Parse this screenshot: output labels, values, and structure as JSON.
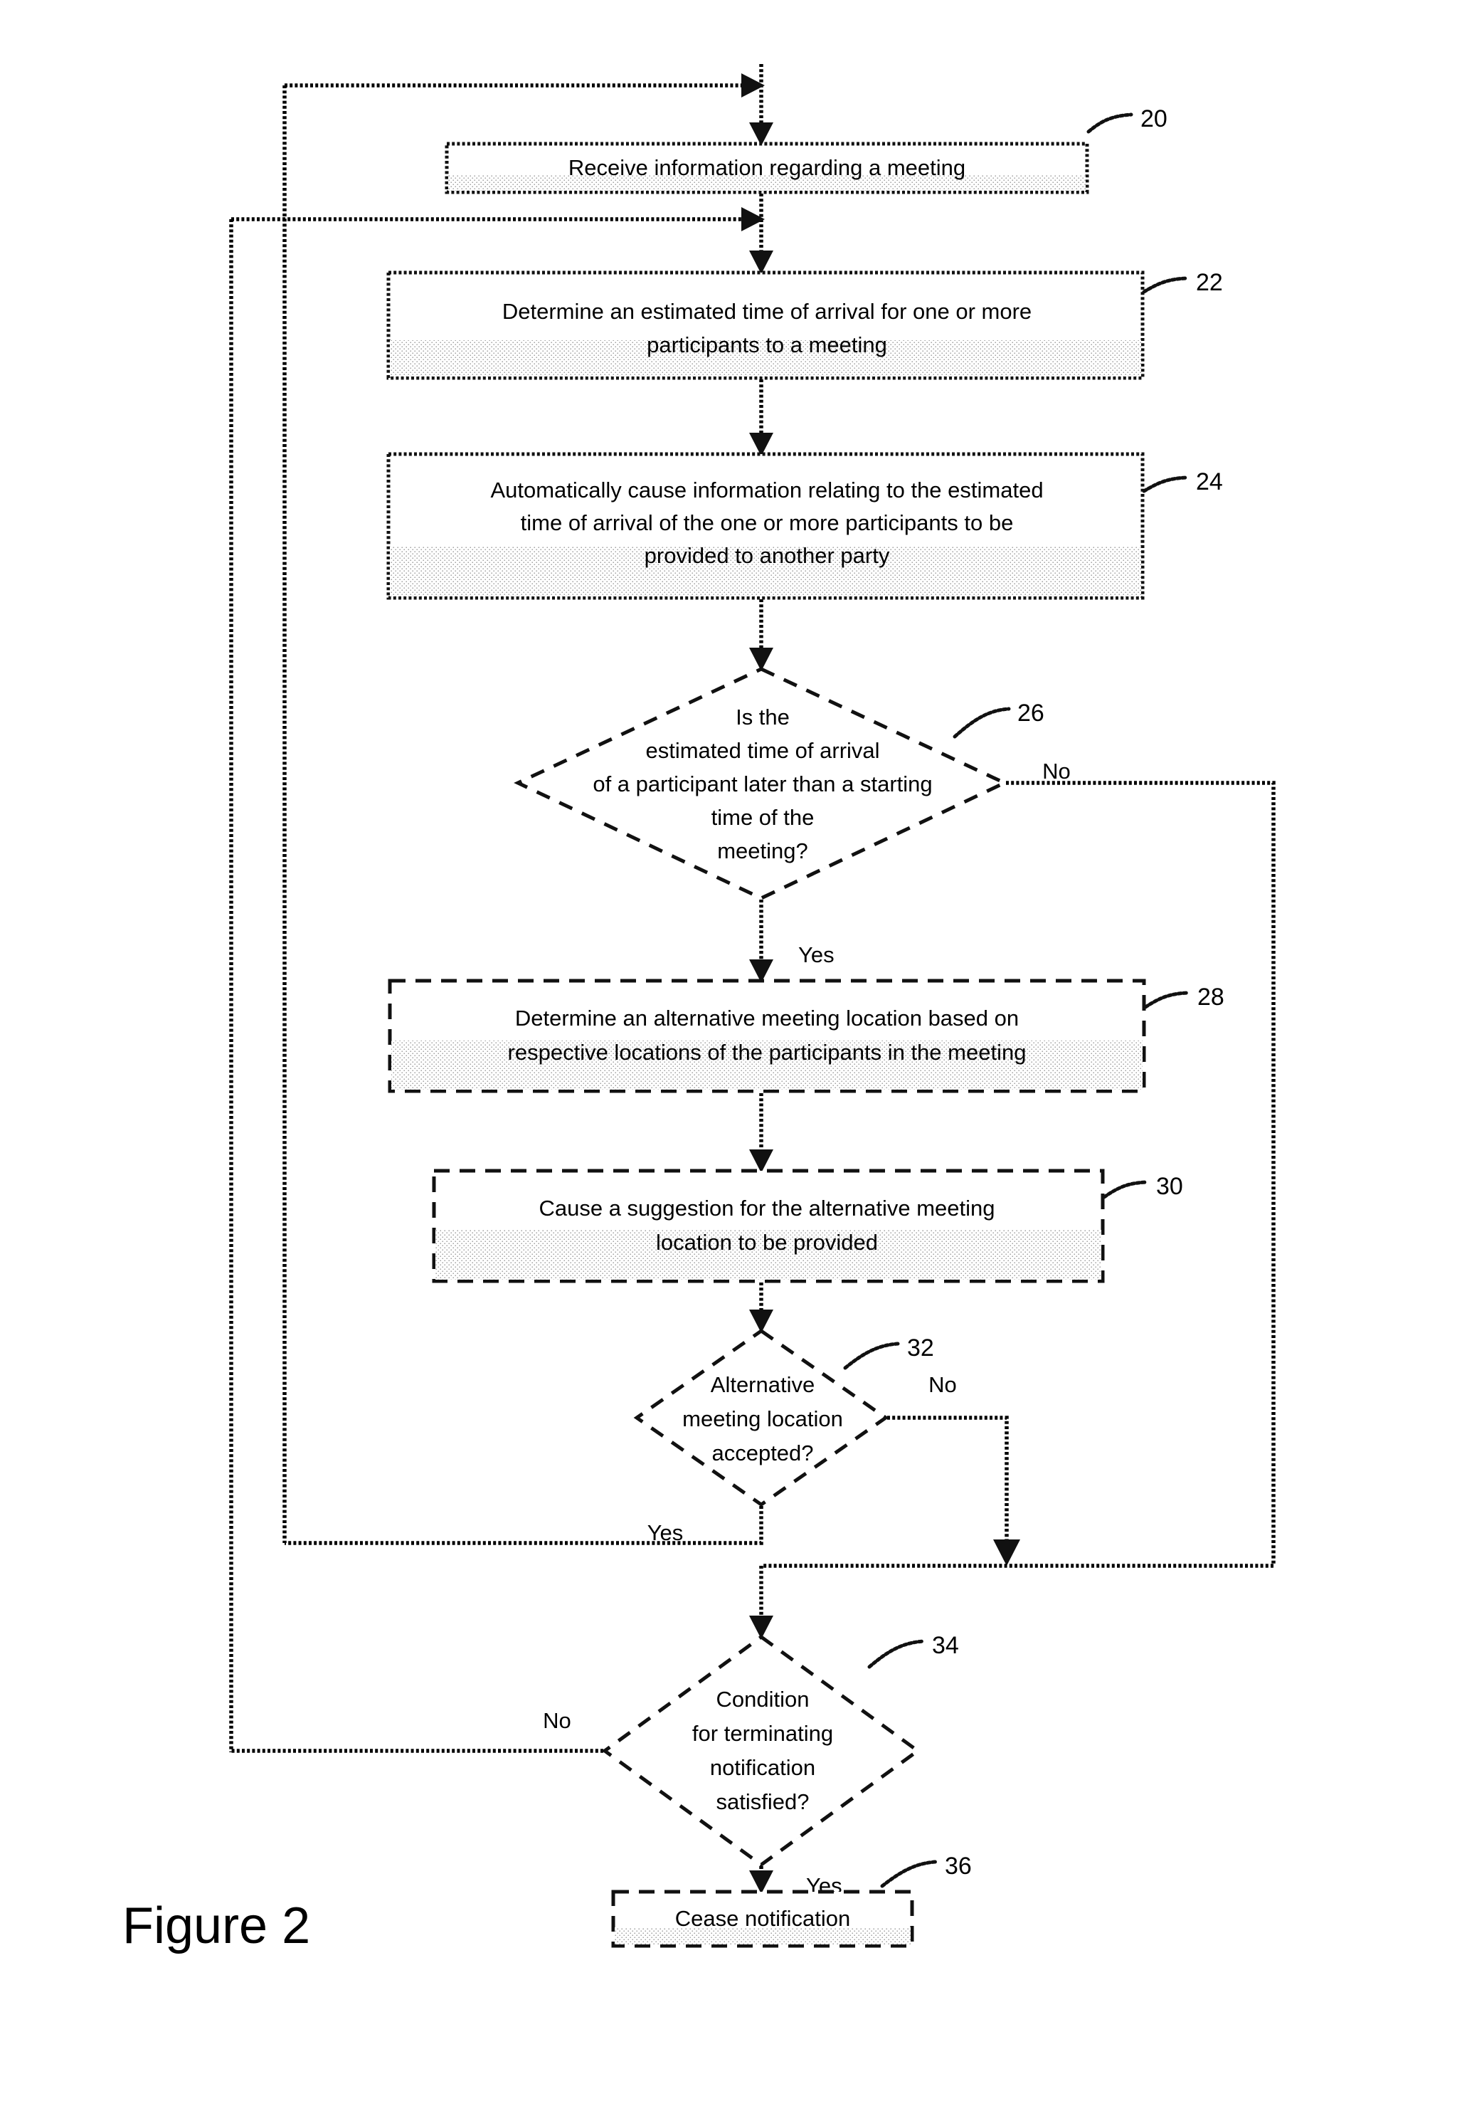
{
  "figure": {
    "caption": "Figure 2",
    "type": "patent-flowchart"
  },
  "nodes": [
    {
      "id": "n20",
      "ref": "20",
      "shape": "process",
      "border": "solid",
      "lines": [
        "Receive information regarding a meeting"
      ]
    },
    {
      "id": "n22",
      "ref": "22",
      "shape": "process",
      "border": "solid",
      "lines": [
        "Determine an estimated time of arrival for one or more",
        "participants to a meeting"
      ]
    },
    {
      "id": "n24",
      "ref": "24",
      "shape": "process",
      "border": "solid",
      "lines": [
        "Automatically cause information relating to the estimated",
        "time of arrival of the one or more participants to be",
        "provided to another party"
      ]
    },
    {
      "id": "n26",
      "ref": "26",
      "shape": "decision",
      "border": "dashed",
      "lines": [
        "Is the",
        "estimated time of arrival",
        "of a participant later than a starting",
        "time of the",
        "meeting?"
      ]
    },
    {
      "id": "n28",
      "ref": "28",
      "shape": "process",
      "border": "dashed",
      "lines": [
        "Determine an alternative meeting location based on",
        "respective locations of the participants in the meeting"
      ]
    },
    {
      "id": "n30",
      "ref": "30",
      "shape": "process",
      "border": "dashed",
      "lines": [
        "Cause a suggestion for the alternative meeting",
        "location to be provided"
      ]
    },
    {
      "id": "n32",
      "ref": "32",
      "shape": "decision",
      "border": "dashed",
      "lines": [
        "Alternative",
        "meeting location",
        "accepted?"
      ]
    },
    {
      "id": "n34",
      "ref": "34",
      "shape": "decision",
      "border": "dashed",
      "lines": [
        "Condition",
        "for terminating",
        "notification",
        "satisfied?"
      ]
    },
    {
      "id": "n36",
      "ref": "36",
      "shape": "process",
      "border": "dashed",
      "lines": [
        "Cease notification"
      ]
    }
  ],
  "branch_labels": {
    "d26_no": "No",
    "d26_yes": "Yes",
    "d32_no": "No",
    "d32_yes": "Yes",
    "d34_no": "No",
    "d34_yes": "Yes"
  },
  "ref_numbers": {
    "n20": "20",
    "n22": "22",
    "n24": "24",
    "n26": "26",
    "n28": "28",
    "n30": "30",
    "n32": "32",
    "n34": "34",
    "n36": "36"
  },
  "colors": {
    "line": "#111111",
    "text": "#000000",
    "background": "#ffffff",
    "shade": "#f0f0f0"
  }
}
